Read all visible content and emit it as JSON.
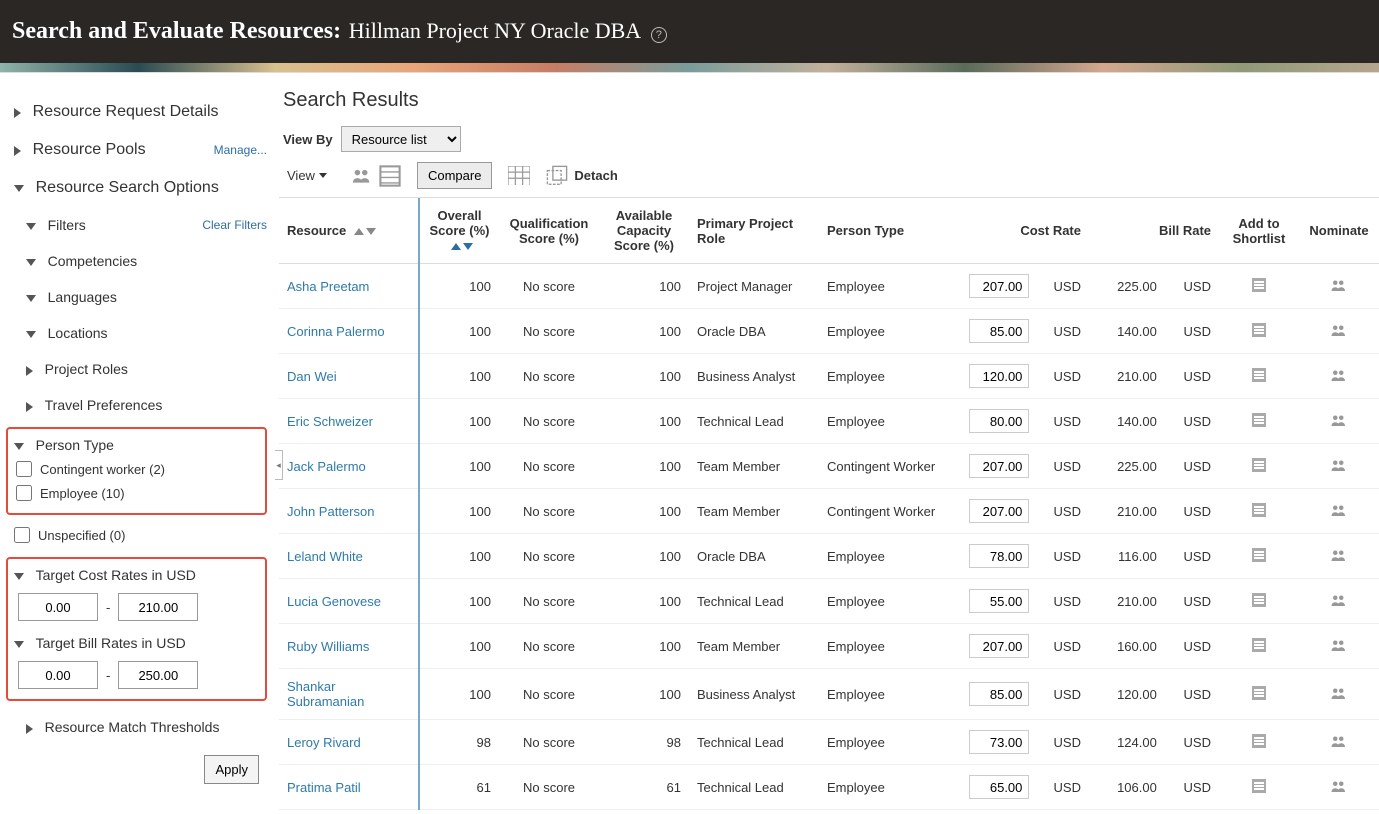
{
  "header": {
    "title_prefix": "Search and Evaluate Resources:",
    "title_project": "Hillman Project NY Oracle DBA"
  },
  "sidebar": {
    "resource_request_details": "Resource Request Details",
    "resource_pools": "Resource Pools",
    "manage_link": "Manage...",
    "resource_search_options": "Resource Search Options",
    "filters": "Filters",
    "clear_filters": "Clear Filters",
    "competencies": "Competencies",
    "languages": "Languages",
    "locations": "Locations",
    "project_roles": "Project Roles",
    "travel_preferences": "Travel Preferences",
    "person_type": {
      "label": "Person Type",
      "options": [
        {
          "label": "Contingent worker (2)",
          "checked": false
        },
        {
          "label": "Employee (10)",
          "checked": false
        },
        {
          "label": "Unspecified (0)",
          "checked": false
        }
      ]
    },
    "target_cost": {
      "label": "Target Cost Rates in USD",
      "min": "0.00",
      "max": "210.00"
    },
    "target_bill": {
      "label": "Target Bill Rates in USD",
      "min": "0.00",
      "max": "250.00"
    },
    "resource_match_thresholds": "Resource Match Thresholds",
    "apply_label": "Apply"
  },
  "results": {
    "title": "Search Results",
    "view_by_label": "View By",
    "view_by_value": "Resource list",
    "view_menu": "View",
    "compare_label": "Compare",
    "detach_label": "Detach",
    "columns": {
      "resource": "Resource",
      "overall": "Overall Score (%)",
      "qualification": "Qualification Score (%)",
      "capacity": "Available Capacity Score (%)",
      "role": "Primary Project Role",
      "person_type": "Person Type",
      "cost_rate": "Cost Rate",
      "bill_rate": "Bill Rate",
      "shortlist": "Add to Shortlist",
      "nominate": "Nominate"
    },
    "no_score": "No score",
    "usd": "USD",
    "rows": [
      {
        "name": "Asha Preetam",
        "overall": "100",
        "qual": "No score",
        "cap": "100",
        "role": "Project Manager",
        "ptype": "Employee",
        "cost": "207.00",
        "bill": "225.00"
      },
      {
        "name": "Corinna Palermo",
        "overall": "100",
        "qual": "No score",
        "cap": "100",
        "role": "Oracle DBA",
        "ptype": "Employee",
        "cost": "85.00",
        "bill": "140.00"
      },
      {
        "name": "Dan Wei",
        "overall": "100",
        "qual": "No score",
        "cap": "100",
        "role": "Business Analyst",
        "ptype": "Employee",
        "cost": "120.00",
        "bill": "210.00"
      },
      {
        "name": "Eric Schweizer",
        "overall": "100",
        "qual": "No score",
        "cap": "100",
        "role": "Technical Lead",
        "ptype": "Employee",
        "cost": "80.00",
        "bill": "140.00"
      },
      {
        "name": "Jack  Palermo",
        "overall": "100",
        "qual": "No score",
        "cap": "100",
        "role": "Team Member",
        "ptype": "Contingent Worker",
        "cost": "207.00",
        "bill": "225.00"
      },
      {
        "name": "John  Patterson",
        "overall": "100",
        "qual": "No score",
        "cap": "100",
        "role": "Team Member",
        "ptype": "Contingent Worker",
        "cost": "207.00",
        "bill": "210.00"
      },
      {
        "name": "Leland White",
        "overall": "100",
        "qual": "No score",
        "cap": "100",
        "role": "Oracle DBA",
        "ptype": "Employee",
        "cost": "78.00",
        "bill": "116.00"
      },
      {
        "name": "Lucia Genovese",
        "overall": "100",
        "qual": "No score",
        "cap": "100",
        "role": "Technical Lead",
        "ptype": "Employee",
        "cost": "55.00",
        "bill": "210.00"
      },
      {
        "name": "Ruby Williams",
        "overall": "100",
        "qual": "No score",
        "cap": "100",
        "role": "Team Member",
        "ptype": "Employee",
        "cost": "207.00",
        "bill": "160.00"
      },
      {
        "name": "Shankar Subramanian",
        "overall": "100",
        "qual": "No score",
        "cap": "100",
        "role": "Business Analyst",
        "ptype": "Employee",
        "cost": "85.00",
        "bill": "120.00"
      },
      {
        "name": "Leroy Rivard",
        "overall": "98",
        "qual": "No score",
        "cap": "98",
        "role": "Technical Lead",
        "ptype": "Employee",
        "cost": "73.00",
        "bill": "124.00"
      },
      {
        "name": "Pratima Patil",
        "overall": "61",
        "qual": "No score",
        "cap": "61",
        "role": "Technical Lead",
        "ptype": "Employee",
        "cost": "65.00",
        "bill": "106.00"
      }
    ]
  }
}
